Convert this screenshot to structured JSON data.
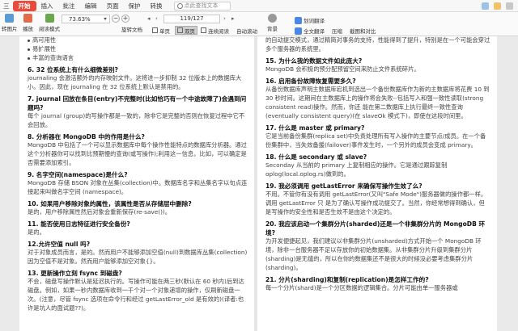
{
  "menubar": {
    "items": [
      "三",
      "开始",
      "插入",
      "批注",
      "编辑",
      "页面",
      "保护",
      "转换"
    ],
    "search_placeholder": "点此查找文本",
    "accent": "#e84b3c"
  },
  "toolbar": {
    "left_items": [
      "转图片",
      "播放",
      "阅读模式"
    ],
    "zoom": "73.63%",
    "page_indicator": "119/127",
    "rotate_label": "旋转文档",
    "view_single": "单页",
    "view_double": "双页",
    "view_continuous": "连续阅读",
    "auto_scroll": "自动滚动",
    "background": "背景",
    "translate_label": "划词翻译",
    "fulltext_translate": "全文翻译",
    "compress": "压缩",
    "screenshot_compare": "截图和对比"
  },
  "left_page": {
    "blocks": [
      {
        "type": "bullet",
        "text": "高可用性"
      },
      {
        "type": "bullet",
        "text": "易扩展性"
      },
      {
        "type": "bullet",
        "text": "丰富的查询语言"
      },
      {
        "type": "q",
        "text": "6. 32 位系统上有什么细微差别?"
      },
      {
        "type": "p",
        "text": "journaling 会激活额外的内存映射文件。这将进一步抑制 32 位版本上的数据库大小。因此，现在 journaling 在 32 位系统上默认是禁用的。"
      },
      {
        "type": "q",
        "text": "7. journal 回放在条目(entry)不完整时(比如恰巧有一个中途故障了)会遇到问题吗?"
      },
      {
        "type": "p",
        "text": "每个 journal (group)的写操作都是一致的，除非它是完整的否则在恢复过程中它不会回放。"
      },
      {
        "type": "q",
        "text": "8. 分析器在 MongoDB 中的作用是什么?"
      },
      {
        "type": "p",
        "text": "MongoDB 中包括了一个可以显示数据库中每个操作性能特点的数据库分析器。通过这个分析器你可以找到比预期慢的查询(或写操作);利用这一信息，比如，可以确定是否需要添加索引。"
      },
      {
        "type": "q",
        "text": "9. 名字空间(namespace)是什么?"
      },
      {
        "type": "p",
        "text": "MongoDB 存储 BSON 对象在丛集(collection)中。数据库名字和丛集名字以句点连接起来叫做名字空间 (namespace)。"
      },
      {
        "type": "q",
        "text": "10. 如果用户移除对象的属性，该属性是否从存储层中删除?"
      },
      {
        "type": "p",
        "text": "是的，用户移除属性然后对象会重新保存(re-save())。"
      },
      {
        "type": "q",
        "text": "11. 能否使用日志特征进行安全备份?"
      },
      {
        "type": "p",
        "text": "是的。"
      },
      {
        "type": "q",
        "text": "12.允许空值 null 吗?"
      },
      {
        "type": "p",
        "text": "对于对象成员而言，是的。然而用户不能够添加空值(null)到数据库丛集(collection)因为空值不是对象。然而用户能够添加空对象{}。"
      },
      {
        "type": "q",
        "text": "13. 更新操作立刻 fsync 到磁盘?"
      },
      {
        "type": "p",
        "text": "不会，磁盘写操作默认是延迟执行的。写操作可能在两三秒(默认在 60 秒内)后到达磁盘。例如，如果一秒内数据库收到一千个对一个对象递增的操作，仅刷新磁盘一次。(注意，尽管 fsync 选项在命令行和经过 getLastError_old 是有效的)(译者:也许是坑人的面试题??)。"
      }
    ]
  },
  "right_page": {
    "blocks": [
      {
        "type": "p",
        "text": "的自动提交模式，通过精简对事务的支持，性能得到了提升，特别是在一个可能会穿过多个服务器的系统里。"
      },
      {
        "type": "q",
        "text": "15. 为什么我的数据文件如此庞大?"
      },
      {
        "type": "p",
        "text": "MongoDB 会积极的预分配预留空间来防止文件系统碎片。"
      },
      {
        "type": "q",
        "text": "16. 启用备份故障恢复需要多久?"
      },
      {
        "type": "p",
        "text": "从备份数据库声明主数据库宕机到选出一个备份数据库作为新的主数据库将花费 10 到 30 秒时间。这期间在主数据库上的操作将会失败--包括写入和强一致性读取(strong consistent read)操作。然而，你还 能在第二数据库上执行最终一致性查询(eventually consistent query)(在 slaveOk 模式下)，即使在这段时间里。"
      },
      {
        "type": "q",
        "text": "17. 什么是 master 或 primary?"
      },
      {
        "type": "p",
        "text": "它是当前备份集群(replica set)中负责处理所有写入操作的主要节点/成员。在一个备份集群中，当失效备援(failover)事件发生时，一个另外的成员会变成 primary。"
      },
      {
        "type": "q",
        "text": "18. 什么是 secondary 或 slave?"
      },
      {
        "type": "p",
        "text": "Seconday 从当前的 primary 上复制相应的操作。它是通过跟踪复制 oplog(local.oplog.rs)做到的。"
      },
      {
        "type": "q",
        "text": "19. 我必须调用 getLastError 来确保写操作生效了么?"
      },
      {
        "type": "p",
        "text": "不用。不管你有没有调用 getLastError(又叫\"Safe Mode\")服务器做的操作都一样。调用 getLastError 只 是为了确认写操作成功提交了。当然，你经常想得到确认，但是写操作的安全性和是否生效不是由这个决定的。"
      },
      {
        "type": "q",
        "text": "20. 我应该启动一个集群分片(sharded)还是一个非集群分片的 MongoDB 环境?"
      },
      {
        "type": "p",
        "text": "为开发便捷起见，我们建议以非集群分片(unsharded)方式开始一个 MongoDB 环境，除非一台服务器不足以存放你的初始数据集。从非集群分片升级到集群分片(sharding)是无缝的，所以在你的数据集还不是很大的时候没必要考虑集群分片(sharding)。"
      },
      {
        "type": "q",
        "text": "21. 分片(sharding)和复制(replication)是怎样工作的?"
      },
      {
        "type": "p",
        "text": "每一个分片(shard)是一个分区数据的逻辑集合。分片可能由单一服务器或"
      }
    ]
  }
}
